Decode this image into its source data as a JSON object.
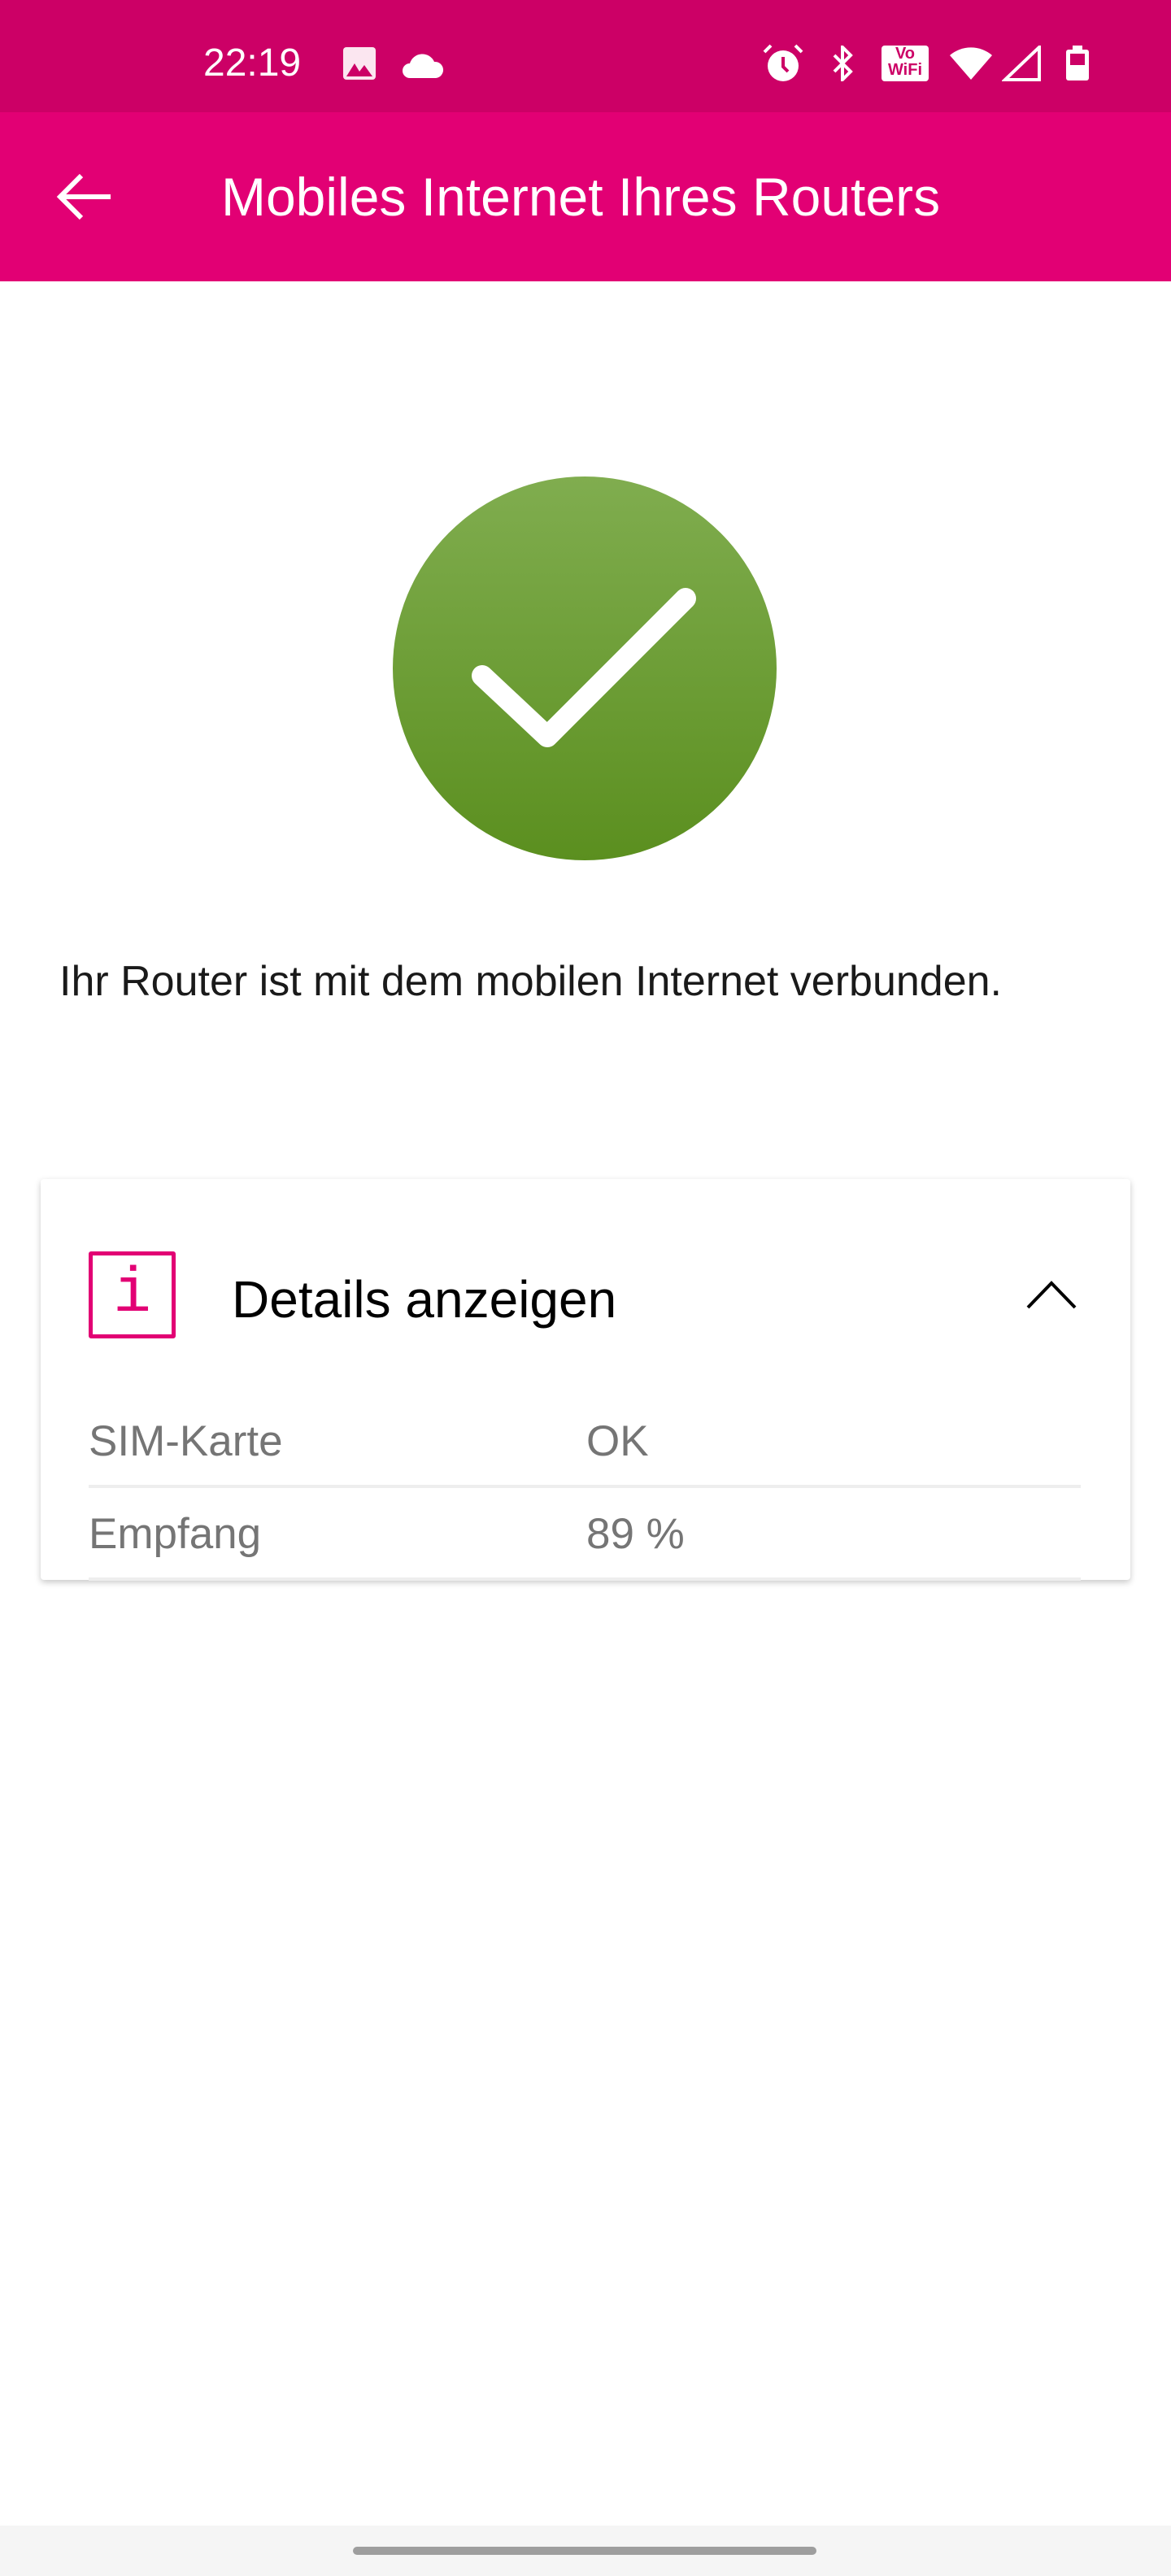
{
  "status_bar": {
    "time": "22:19",
    "left_icons": [
      "image-icon",
      "cloud-icon"
    ],
    "right_icons": [
      "alarm-icon",
      "bluetooth-icon",
      "vowifi-icon",
      "wifi-icon",
      "signal-icon",
      "battery-icon"
    ],
    "vowifi_top": "Vo",
    "vowifi_bottom": "WiFi"
  },
  "app_bar": {
    "title": "Mobiles Internet Ihres Routers",
    "back_icon": "arrow-left-icon"
  },
  "status": {
    "icon": "checkmark-circle-icon",
    "color": "#6b9b32",
    "message": "Ihr Router ist mit dem mobilen Internet verbunden."
  },
  "details": {
    "title": "Details anzeigen",
    "info_glyph": "i",
    "expanded": true,
    "rows": [
      {
        "label": "SIM-Karte",
        "value": "OK"
      },
      {
        "label": "Empfang",
        "value": "89 %"
      }
    ]
  },
  "colors": {
    "brand": "#e20074",
    "status_bar": "#cc0066"
  }
}
